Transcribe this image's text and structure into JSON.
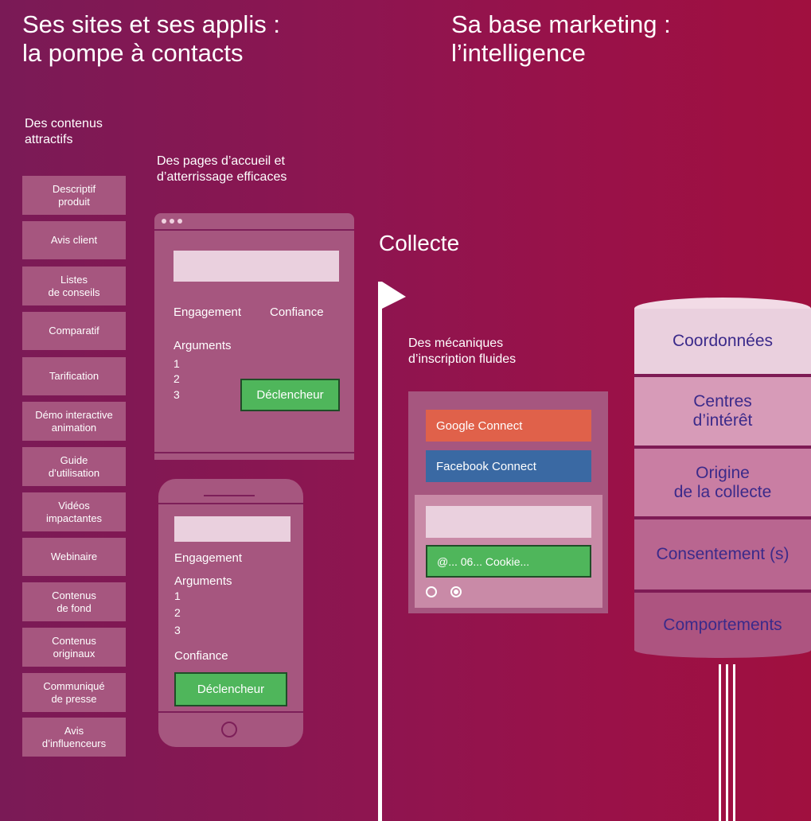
{
  "headings": {
    "sites_line1": "Ses sites et ses applis :",
    "sites_line2": "la pompe à contacts",
    "base_line1": "Sa base marketing :",
    "base_line2": "l’intelligence"
  },
  "contents": {
    "label_line1": "Des contenus",
    "label_line2": "attractifs",
    "items": [
      {
        "l1": "Descriptif",
        "l2": "produit"
      },
      {
        "l1": "Avis client",
        "l2": ""
      },
      {
        "l1": "Listes",
        "l2": "de conseils"
      },
      {
        "l1": "Comparatif",
        "l2": ""
      },
      {
        "l1": "Tarification",
        "l2": ""
      },
      {
        "l1": "Démo interactive",
        "l2": "animation"
      },
      {
        "l1": "Guide",
        "l2": "d’utilisation"
      },
      {
        "l1": "Vidéos",
        "l2": "impactantes"
      },
      {
        "l1": "Webinaire",
        "l2": ""
      },
      {
        "l1": "Contenus",
        "l2": "de fond"
      },
      {
        "l1": "Contenus",
        "l2": "originaux"
      },
      {
        "l1": "Communiqué",
        "l2": "de presse"
      },
      {
        "l1": "Avis",
        "l2": "d’influenceurs"
      }
    ]
  },
  "landing": {
    "label_line1": "Des pages d’accueil et",
    "label_line2": "d’atterrissage efficaces",
    "desktop": {
      "engagement": "Engagement",
      "confiance": "Confiance",
      "arguments": "Arguments",
      "n1": "1",
      "n2": "2",
      "n3": "3",
      "trigger": "Déclencheur"
    },
    "mobile": {
      "engagement": "Engagement",
      "arguments": "Arguments",
      "n1": "1",
      "n2": "2",
      "n3": "3",
      "confiance": "Confiance",
      "trigger": "Déclencheur"
    }
  },
  "collecte": {
    "title": "Collecte",
    "label_line1": "Des mécaniques",
    "label_line2": "d’inscription fluides",
    "google": "Google Connect",
    "facebook": "Facebook Connect",
    "submit": "@... 06... Cookie...",
    "colors": {
      "google": "#e0614a",
      "facebook": "#3a69a3",
      "submit": "#4fb65b"
    }
  },
  "database": {
    "segments": [
      {
        "l1": "Coordonnées",
        "l2": ""
      },
      {
        "l1": "Centres",
        "l2": "d’intérêt"
      },
      {
        "l1": "Origine",
        "l2": "de la collecte"
      },
      {
        "l1": "Consentement (s)",
        "l2": ""
      },
      {
        "l1": "Comportements",
        "l2": ""
      }
    ]
  }
}
